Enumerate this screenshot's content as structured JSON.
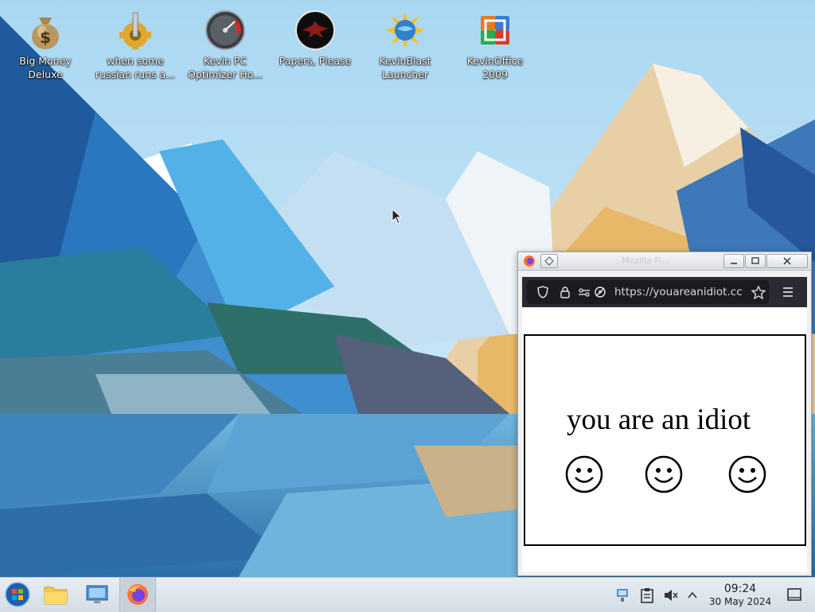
{
  "desktop": {
    "icons": [
      {
        "label": "Big Money\nDeluxe",
        "icon": "money-bag-icon"
      },
      {
        "label": "when some\nrussian runs a...",
        "icon": "gear-cog-icon"
      },
      {
        "label": "Kevin PC\nOptimizer Ho...",
        "icon": "speedometer-gauge-icon"
      },
      {
        "label": "Papers, Please",
        "icon": "eagle-emblem-icon"
      },
      {
        "label": "KevinBlast\nLauncher",
        "icon": "globe-burst-icon"
      },
      {
        "label": "KevinOffice\n2009",
        "icon": "office-logo-icon"
      }
    ]
  },
  "browser": {
    "title": "Mozilla Fi...",
    "url": "https://youareanidiot.cc",
    "page": {
      "message": "you are an idiot",
      "smiley_count": 3
    }
  },
  "taskbar": {
    "items": [
      "start-menu",
      "file-manager",
      "system-settings",
      "firefox"
    ],
    "tray": [
      "network-icon",
      "clipboard-icon",
      "volume-muted-icon",
      "expand-tray-icon"
    ],
    "time": "09:24",
    "date": "30 May 2024"
  },
  "colors": {
    "taskbar_bg": "#dce3ea",
    "browser_toolbar": "#2b2a33",
    "urlbar": "#1c1b22"
  }
}
